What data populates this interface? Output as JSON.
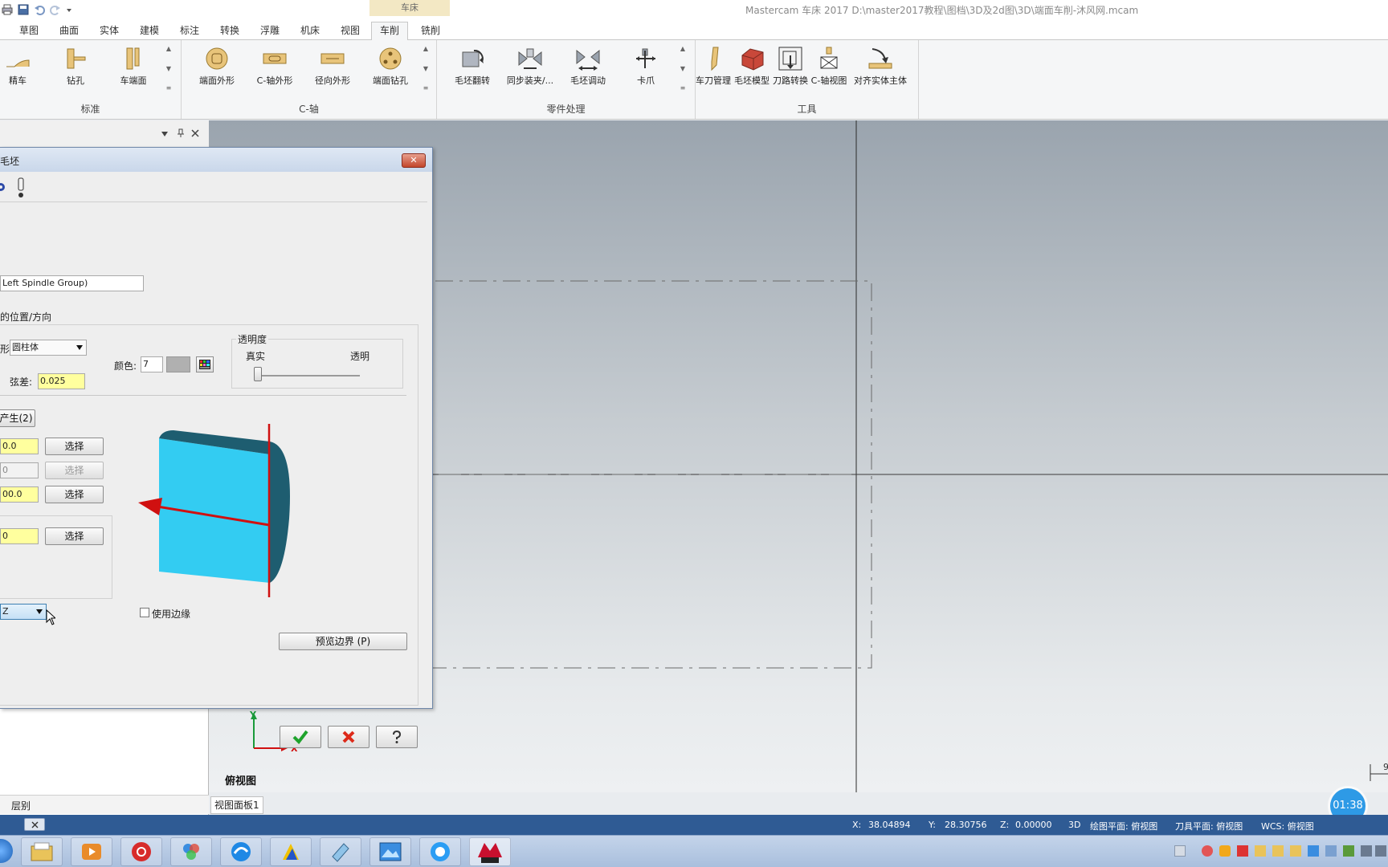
{
  "window": {
    "title": "Mastercam 车床 2017  D:\\master2017教程\\图档\\3D及2d图\\3D\\端面车削-沐风网.mcam",
    "context_tab": "车床"
  },
  "menu_tabs": [
    "草图",
    "曲面",
    "实体",
    "建模",
    "标注",
    "转换",
    "浮雕",
    "机床",
    "视图",
    "车削",
    "铣削"
  ],
  "ribbon": {
    "groups": [
      {
        "label": "标准",
        "buttons": [
          "精车",
          "钻孔",
          "车端面"
        ]
      },
      {
        "label": "C-轴",
        "buttons": [
          "端面外形",
          "C-轴外形",
          "径向外形",
          "端面钻孔"
        ]
      },
      {
        "label": "零件处理",
        "buttons": [
          "毛坯翻转",
          "同步装夹/...",
          "毛坯调动",
          "卡爪"
        ]
      },
      {
        "label": "工具",
        "buttons": [
          "车刀管理",
          "毛坯模型",
          "刀路转换",
          "C-轴视图",
          "对齐实体主体"
        ]
      }
    ]
  },
  "dialog": {
    "title": "毛坯",
    "close_label": "✕",
    "group_name": "Left Spindle Group)",
    "position_label": "的位置/方向",
    "shape_label": "形:",
    "shape_value": "圆柱体",
    "chord_label": "弦差:",
    "chord_value": "0.025",
    "color_label": "颜色:",
    "color_value": "7",
    "transparency": {
      "title": "透明度",
      "left": "真实",
      "right": "透明"
    },
    "make_button": "产生(2)",
    "fields": [
      {
        "value": "0.0",
        "button": "选择"
      },
      {
        "value": "0",
        "button": "选择"
      },
      {
        "value": "00.0",
        "button": "选择"
      },
      {
        "value": "0",
        "button": "选择"
      }
    ],
    "edge_label": "使用边缘",
    "preview_button": "预览边界 (P)",
    "dropdown_value": "Z"
  },
  "panel": {
    "tab_right": "层别"
  },
  "viewport": {
    "view_name": "俯视图",
    "tab": "视图面板1",
    "axis_x": "X",
    "axis_y": "Y",
    "edge_number": "9"
  },
  "status": {
    "x_label": "X:",
    "x_value": "38.04894",
    "y_label": "Y:",
    "y_value": "28.30756",
    "z_label": "Z:",
    "z_value": "0.00000",
    "mode": "3D",
    "plane": "绘图平面: 俯视图",
    "tool_plane": "刀具平面: 俯视图",
    "wcs": "WCS: 俯视图"
  },
  "timer": "01:38",
  "colors": {
    "accent": "#2f5b94",
    "stock": "#33ccf2",
    "axis_red": "#d01010"
  }
}
